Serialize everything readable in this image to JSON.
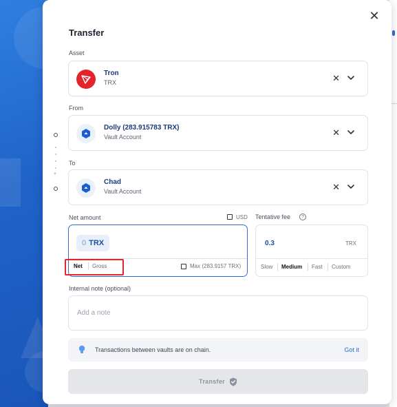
{
  "dialog": {
    "title": "Transfer",
    "close_icon": "close-icon"
  },
  "asset": {
    "label": "Asset",
    "name": "Tron",
    "symbol": "TRX",
    "icon": "tron-icon",
    "icon_color": "#e5232b"
  },
  "from": {
    "label": "From",
    "name": "Dolly (283.915783 TRX)",
    "type": "Vault Account",
    "icon": "vault-icon"
  },
  "to": {
    "label": "To",
    "name": "Chad",
    "type": "Vault Account",
    "icon": "vault-icon"
  },
  "amount": {
    "label": "Net amount",
    "usd_label": "USD",
    "value": "0",
    "currency": "TRX",
    "modes": [
      "Net",
      "Gross"
    ],
    "selected_mode": "Net",
    "max_label": "Max (283.9157 TRX)"
  },
  "fee": {
    "label": "Tentative fee",
    "help_icon": "help-icon",
    "value": "0.3",
    "currency": "TRX",
    "options": [
      "Slow",
      "Medium",
      "Fast",
      "Custom"
    ],
    "selected": "Medium"
  },
  "note": {
    "label": "Internal note (optional)",
    "placeholder": "Add a note",
    "value": ""
  },
  "info": {
    "text": "Transactions between vaults are on chain.",
    "action": "Got it",
    "icon": "lightbulb-icon"
  },
  "submit": {
    "label": "Transfer",
    "icon": "shield-check-icon",
    "enabled": false
  },
  "colors": {
    "accent": "#2a6fd6",
    "highlight": "#e0262b",
    "title_blue": "#1a3a7a"
  }
}
